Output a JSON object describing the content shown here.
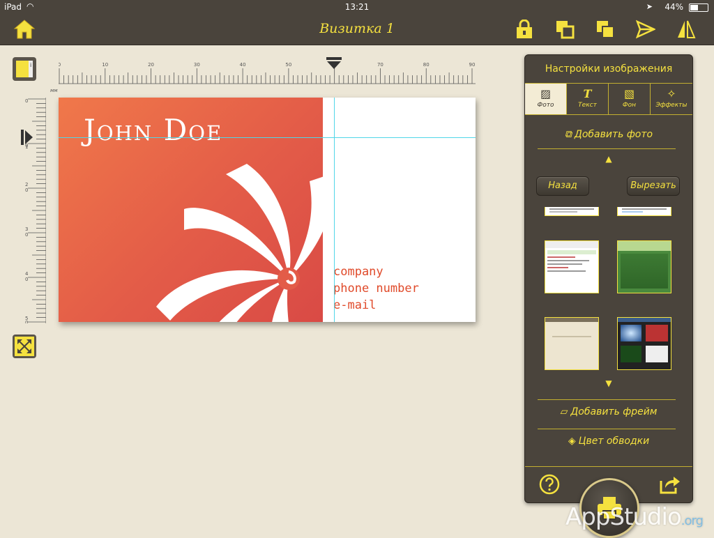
{
  "status": {
    "device": "iPad",
    "time": "13:21",
    "battery": "44%"
  },
  "nav": {
    "title": "Визитка 1"
  },
  "ruler": {
    "unit": "мм",
    "h_ticks": [
      "0",
      "10",
      "20",
      "30",
      "40",
      "50",
      "60",
      "70",
      "80",
      "90"
    ],
    "v_ticks": [
      "0",
      "0",
      "1",
      "2",
      "0",
      "3",
      "0",
      "4",
      "0",
      "5",
      "0"
    ]
  },
  "card": {
    "name": "John Doe",
    "company": "company",
    "phone": "phone number",
    "email": "e-mail"
  },
  "panel": {
    "title": "Настройки изображения",
    "tabs": [
      {
        "label": "Фото"
      },
      {
        "label": "Текст"
      },
      {
        "label": "Фон"
      },
      {
        "label": "Эффекты"
      }
    ],
    "add_photo": "Добавить фото",
    "back": "Назад",
    "crop": "Вырезать",
    "add_frame": "Добавить фрейм",
    "stroke_color": "Цвет обводки"
  },
  "watermark": {
    "brand": "AppStudio",
    "tld": ".org"
  },
  "colors": {
    "accent": "#f5e13f",
    "bar": "#4a443c",
    "canvas": "#ece6d6",
    "card_orange": "#e35c48"
  }
}
